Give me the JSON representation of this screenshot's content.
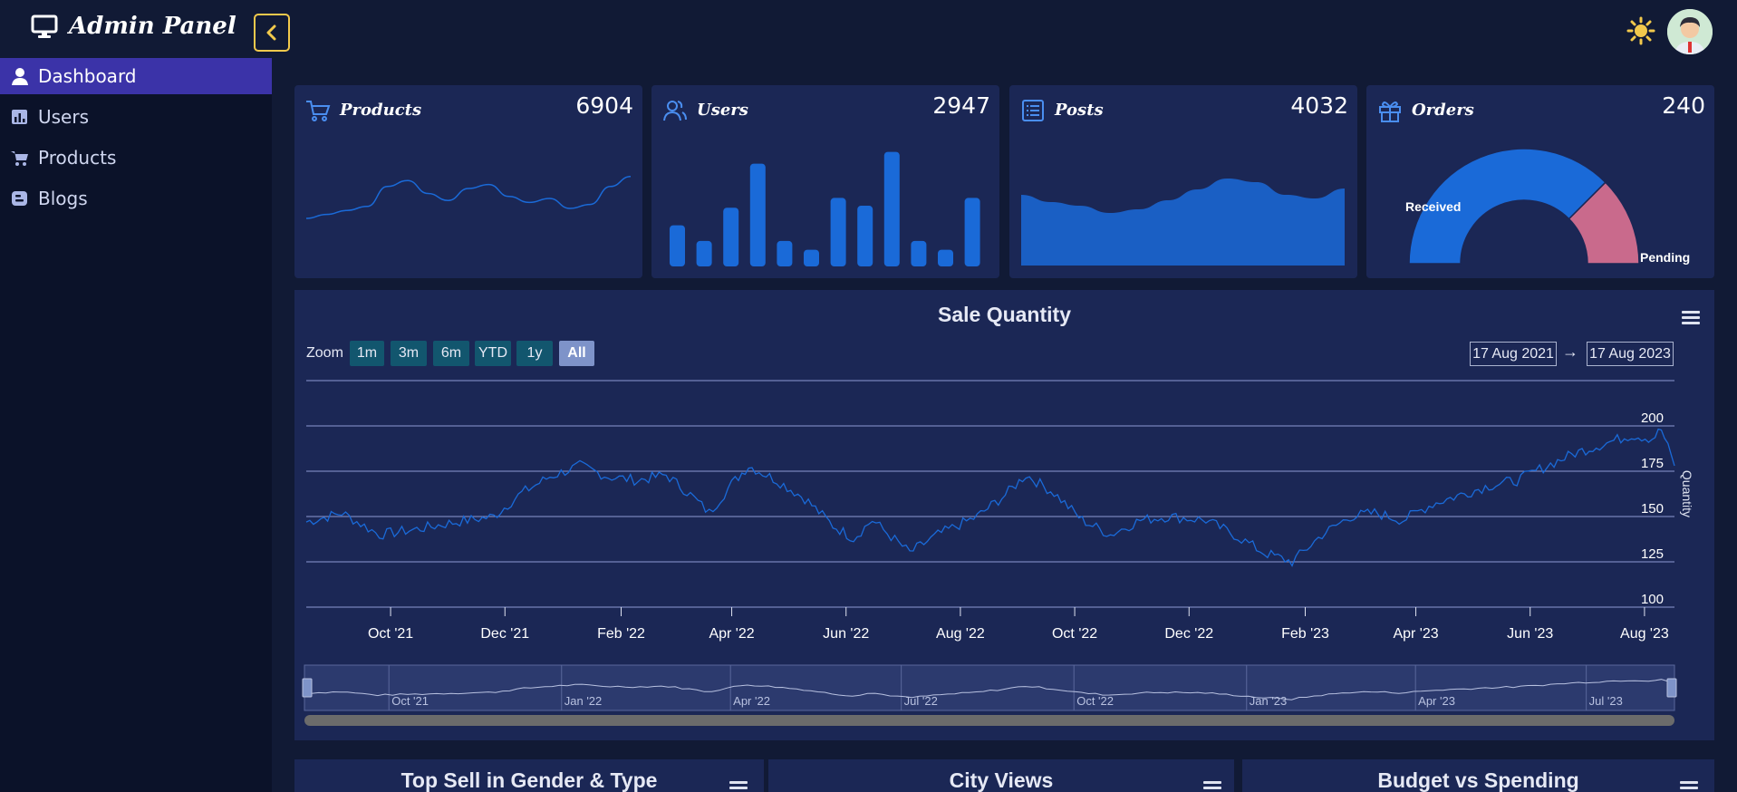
{
  "header": {
    "title": "Admin Panel"
  },
  "sidebar": {
    "items": [
      {
        "label": "Dashboard",
        "icon": "user-icon",
        "active": true
      },
      {
        "label": "Users",
        "icon": "bar-chart-icon",
        "active": false
      },
      {
        "label": "Products",
        "icon": "cart-icon",
        "active": false
      },
      {
        "label": "Blogs",
        "icon": "blog-icon",
        "active": false
      }
    ]
  },
  "stats": [
    {
      "title": "Products",
      "value": "6904",
      "icon": "cart-icon"
    },
    {
      "title": "Users",
      "value": "2947",
      "icon": "users-icon"
    },
    {
      "title": "Posts",
      "value": "4032",
      "icon": "list-icon"
    },
    {
      "title": "Orders",
      "value": "240",
      "icon": "gift-icon"
    }
  ],
  "orders_gauge": {
    "labels": [
      "Received",
      "Pending"
    ],
    "values": [
      75,
      25
    ],
    "colors": [
      "#1a6ad8",
      "#c96a8c"
    ]
  },
  "sale_quantity": {
    "title": "Sale Quantity",
    "zoom_label": "Zoom",
    "zoom_buttons": [
      "1m",
      "3m",
      "6m",
      "YTD",
      "1y",
      "All"
    ],
    "active_zoom": "All",
    "from_date": "17 Aug 2021",
    "to_date": "17 Aug 2023",
    "arrow": "→",
    "navigator_ticks": [
      "Oct '21",
      "Jan '22",
      "Apr '22",
      "Jul '22",
      "Oct '22",
      "Jan '23",
      "Apr '23",
      "Jul '23"
    ]
  },
  "bottom_cards": [
    {
      "title": "Top Sell in Gender & Type"
    },
    {
      "title": "City Views"
    },
    {
      "title": "Budget vs Spending"
    }
  ],
  "colors": {
    "accent": "#1a6ad8",
    "sidebar_active": "#3b33a8",
    "card_bg": "#1b2755",
    "page_bg": "#111a35"
  },
  "chart_data": [
    {
      "type": "line",
      "name": "products-sparkline",
      "values": [
        30,
        34,
        38,
        42,
        62,
        68,
        55,
        48,
        60,
        64,
        52,
        46,
        50,
        40,
        44,
        62,
        72
      ]
    },
    {
      "type": "bar",
      "name": "users-bars",
      "values": [
        42,
        26,
        60,
        105,
        26,
        17,
        70,
        62,
        117,
        26,
        17,
        70
      ]
    },
    {
      "type": "area",
      "name": "posts-area",
      "values": [
        78,
        70,
        66,
        58,
        62,
        72,
        84,
        96,
        92,
        78,
        74,
        85
      ]
    },
    {
      "type": "line",
      "title": "Sale Quantity",
      "ylabel": "Quantity",
      "ylim": [
        100,
        225
      ],
      "yticks": [
        100,
        125,
        150,
        175,
        200
      ],
      "xticks": [
        "Oct '21",
        "Dec '21",
        "Feb '22",
        "Apr '22",
        "Jun '22",
        "Aug '22",
        "Oct '22",
        "Dec '22",
        "Feb '23",
        "Apr '23",
        "Jun '23",
        "Aug '23"
      ],
      "x_start": "2021-08-17",
      "x_end": "2023-08-17",
      "points": [
        [
          "2021-08-17",
          147
        ],
        [
          "2021-09-05",
          152
        ],
        [
          "2021-09-25",
          140
        ],
        [
          "2021-10-15",
          143
        ],
        [
          "2021-11-05",
          147
        ],
        [
          "2021-11-25",
          150
        ],
        [
          "2021-12-10",
          163
        ],
        [
          "2021-12-25",
          172
        ],
        [
          "2022-01-10",
          178
        ],
        [
          "2022-01-25",
          172
        ],
        [
          "2022-02-10",
          170
        ],
        [
          "2022-02-25",
          173
        ],
        [
          "2022-03-10",
          162
        ],
        [
          "2022-03-20",
          152
        ],
        [
          "2022-04-01",
          168
        ],
        [
          "2022-04-10",
          178
        ],
        [
          "2022-04-25",
          170
        ],
        [
          "2022-05-10",
          160
        ],
        [
          "2022-05-25",
          145
        ],
        [
          "2022-06-05",
          138
        ],
        [
          "2022-06-15",
          148
        ],
        [
          "2022-07-05",
          130
        ],
        [
          "2022-07-20",
          140
        ],
        [
          "2022-08-10",
          150
        ],
        [
          "2022-08-25",
          162
        ],
        [
          "2022-09-05",
          173
        ],
        [
          "2022-09-20",
          163
        ],
        [
          "2022-10-05",
          148
        ],
        [
          "2022-10-20",
          140
        ],
        [
          "2022-11-05",
          148
        ],
        [
          "2022-11-20",
          150
        ],
        [
          "2022-12-10",
          148
        ],
        [
          "2022-12-25",
          140
        ],
        [
          "2023-01-10",
          130
        ],
        [
          "2023-01-25",
          125
        ],
        [
          "2023-02-10",
          140
        ],
        [
          "2023-02-25",
          150
        ],
        [
          "2023-03-10",
          152
        ],
        [
          "2023-03-25",
          148
        ],
        [
          "2023-04-10",
          157
        ],
        [
          "2023-04-25",
          162
        ],
        [
          "2023-05-10",
          167
        ],
        [
          "2023-05-25",
          170
        ],
        [
          "2023-06-10",
          178
        ],
        [
          "2023-06-25",
          185
        ],
        [
          "2023-07-10",
          190
        ],
        [
          "2023-07-25",
          195
        ],
        [
          "2023-08-05",
          193
        ],
        [
          "2023-08-10",
          198
        ],
        [
          "2023-08-17",
          178
        ]
      ]
    }
  ]
}
